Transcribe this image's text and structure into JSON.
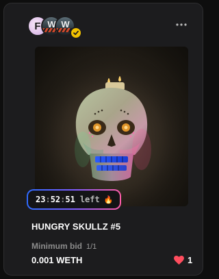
{
  "card": {
    "creators": [
      {
        "icon": "creator-avatar-f",
        "mark": "F"
      },
      {
        "icon": "creator-avatar-w",
        "mark": "W"
      },
      {
        "icon": "creator-avatar-w",
        "mark": "W"
      }
    ],
    "verified_icon": "verified-check-icon",
    "menu_icon": "more-dots-icon",
    "artwork_icon": "skull-artwork",
    "timer": {
      "hours": "23",
      "minutes": "52",
      "seconds": "51",
      "sep": ":",
      "suffix": "left",
      "emoji": "🔥"
    },
    "title": "HUNGRY SKULLZ #5",
    "bid_label": "Minimum bid",
    "edition": "1/1",
    "bid_value": "0.001 WETH",
    "likes": "1",
    "like_icon": "heart-icon"
  },
  "colors": {
    "background": "#0e0e0e",
    "card": "#1c1c1e",
    "verified": "#f2c200",
    "heart": "#ff4d5e",
    "timer_gradient": [
      "#2f6bff",
      "#7d5cff",
      "#ff5ca8"
    ]
  }
}
